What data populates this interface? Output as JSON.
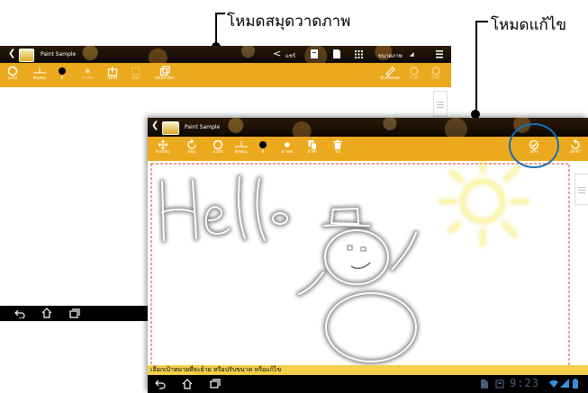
{
  "callouts": {
    "paint_mode": "โหมดสมุดวาดภาพ",
    "edit_mode": "โหมดแก้ไข"
  },
  "back_window": {
    "title": "Paint Sample",
    "actions": {
      "share_label": "แชร์",
      "menu_label": "ขนาดภาพ"
    },
    "tools": [
      {
        "label": "แปรง",
        "icon": "brush-icon"
      },
      {
        "label": "ลักษณะ",
        "icon": "stroke-icon"
      },
      {
        "label": "สี",
        "icon": "color-icon"
      },
      {
        "label": "ยางลบ",
        "icon": "eraser-icon"
      },
      {
        "label": "แทรก",
        "icon": "insert-icon"
      },
      {
        "label": "เลือก",
        "icon": "select-icon"
      },
      {
        "label": "ยกเลิกเลือก",
        "icon": "copy-icon"
      }
    ],
    "right_tools": [
      {
        "label": "ล้างทั้งหมด",
        "icon": "clear-icon"
      },
      {
        "label": "ทำซ้ำ",
        "icon": "redo-icon"
      },
      {
        "label": "ทำซ้ำ",
        "icon": "redo2-icon"
      }
    ]
  },
  "front_window": {
    "title": "Paint Sample",
    "tools": [
      {
        "label": "ย้ายวัตถุ",
        "icon": "move-icon"
      },
      {
        "label": "หมุน",
        "icon": "rotate-icon"
      },
      {
        "label": "แปรง",
        "icon": "brush-icon"
      },
      {
        "label": "ลักษณะ",
        "icon": "stroke-icon"
      },
      {
        "label": "สี",
        "icon": "color-icon"
      },
      {
        "label": "ยางลบ",
        "icon": "eraser-icon"
      },
      {
        "label": "ทำซ้ำ",
        "icon": "duplicate-icon"
      },
      {
        "label": "ลบ",
        "icon": "trash-icon"
      }
    ],
    "done_label": "เสร็จ",
    "undo_label": "เลิกทำ",
    "status_text": "เลือกเป้าหมายที่จะย้าย หรือปรับขนาด หรือแก้ไข",
    "clock": "9:23"
  },
  "colors": {
    "toolbar": "#eba91d",
    "status_bar": "#f3cf4a",
    "selection_border": "#e23b3b",
    "highlight_circle": "#1a6fb5"
  }
}
